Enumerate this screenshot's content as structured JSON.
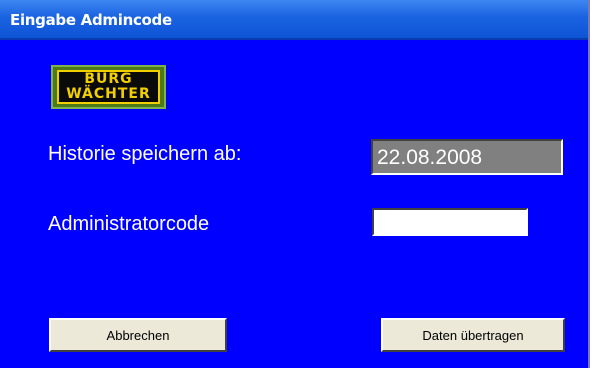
{
  "window": {
    "title": "Eingabe Admincode",
    "accent_color": "#0000ff"
  },
  "logo": {
    "line1": "BURG",
    "line2": "WÄCHTER"
  },
  "form": {
    "history_label": "Historie speichern ab:",
    "history_value": "22.08.2008",
    "admin_label": "Administratorcode",
    "admin_value": ""
  },
  "buttons": {
    "cancel_label": "Abbrechen",
    "submit_label": "Daten übertragen"
  }
}
